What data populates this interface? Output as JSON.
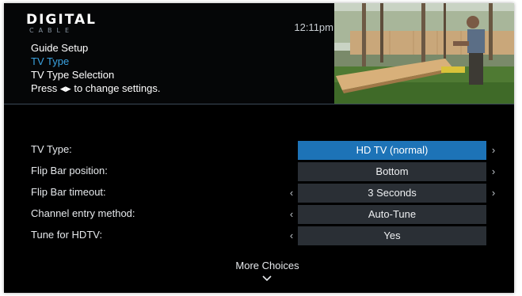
{
  "header": {
    "logo": {
      "main": "DIGITAL",
      "sub": "CABLE"
    },
    "clock": "12:11pm",
    "breadcrumb": {
      "item1": "Guide Setup",
      "item2": "TV Type",
      "item3": "TV Type Selection",
      "hint_prefix": "Press",
      "hint_suffix": "to change settings."
    }
  },
  "settings": [
    {
      "label": "TV Type:",
      "value": "HD TV (normal)",
      "left_arrow": false,
      "right_arrow": true,
      "selected": true
    },
    {
      "label": "Flip Bar position:",
      "value": "Bottom",
      "left_arrow": false,
      "right_arrow": true,
      "selected": false
    },
    {
      "label": "Flip Bar timeout:",
      "value": "3 Seconds",
      "left_arrow": true,
      "right_arrow": true,
      "selected": false
    },
    {
      "label": "Channel entry method:",
      "value": "Auto-Tune",
      "left_arrow": true,
      "right_arrow": false,
      "selected": false
    },
    {
      "label": "Tune for HDTV:",
      "value": "Yes",
      "left_arrow": true,
      "right_arrow": false,
      "selected": false
    }
  ],
  "more": {
    "label": "More Choices",
    "icon": "chevron-down-icon"
  },
  "colors": {
    "selected_accent": "#1d73b7",
    "breadcrumb_active": "#3aa2e0",
    "value_box": "#2a2f35"
  }
}
